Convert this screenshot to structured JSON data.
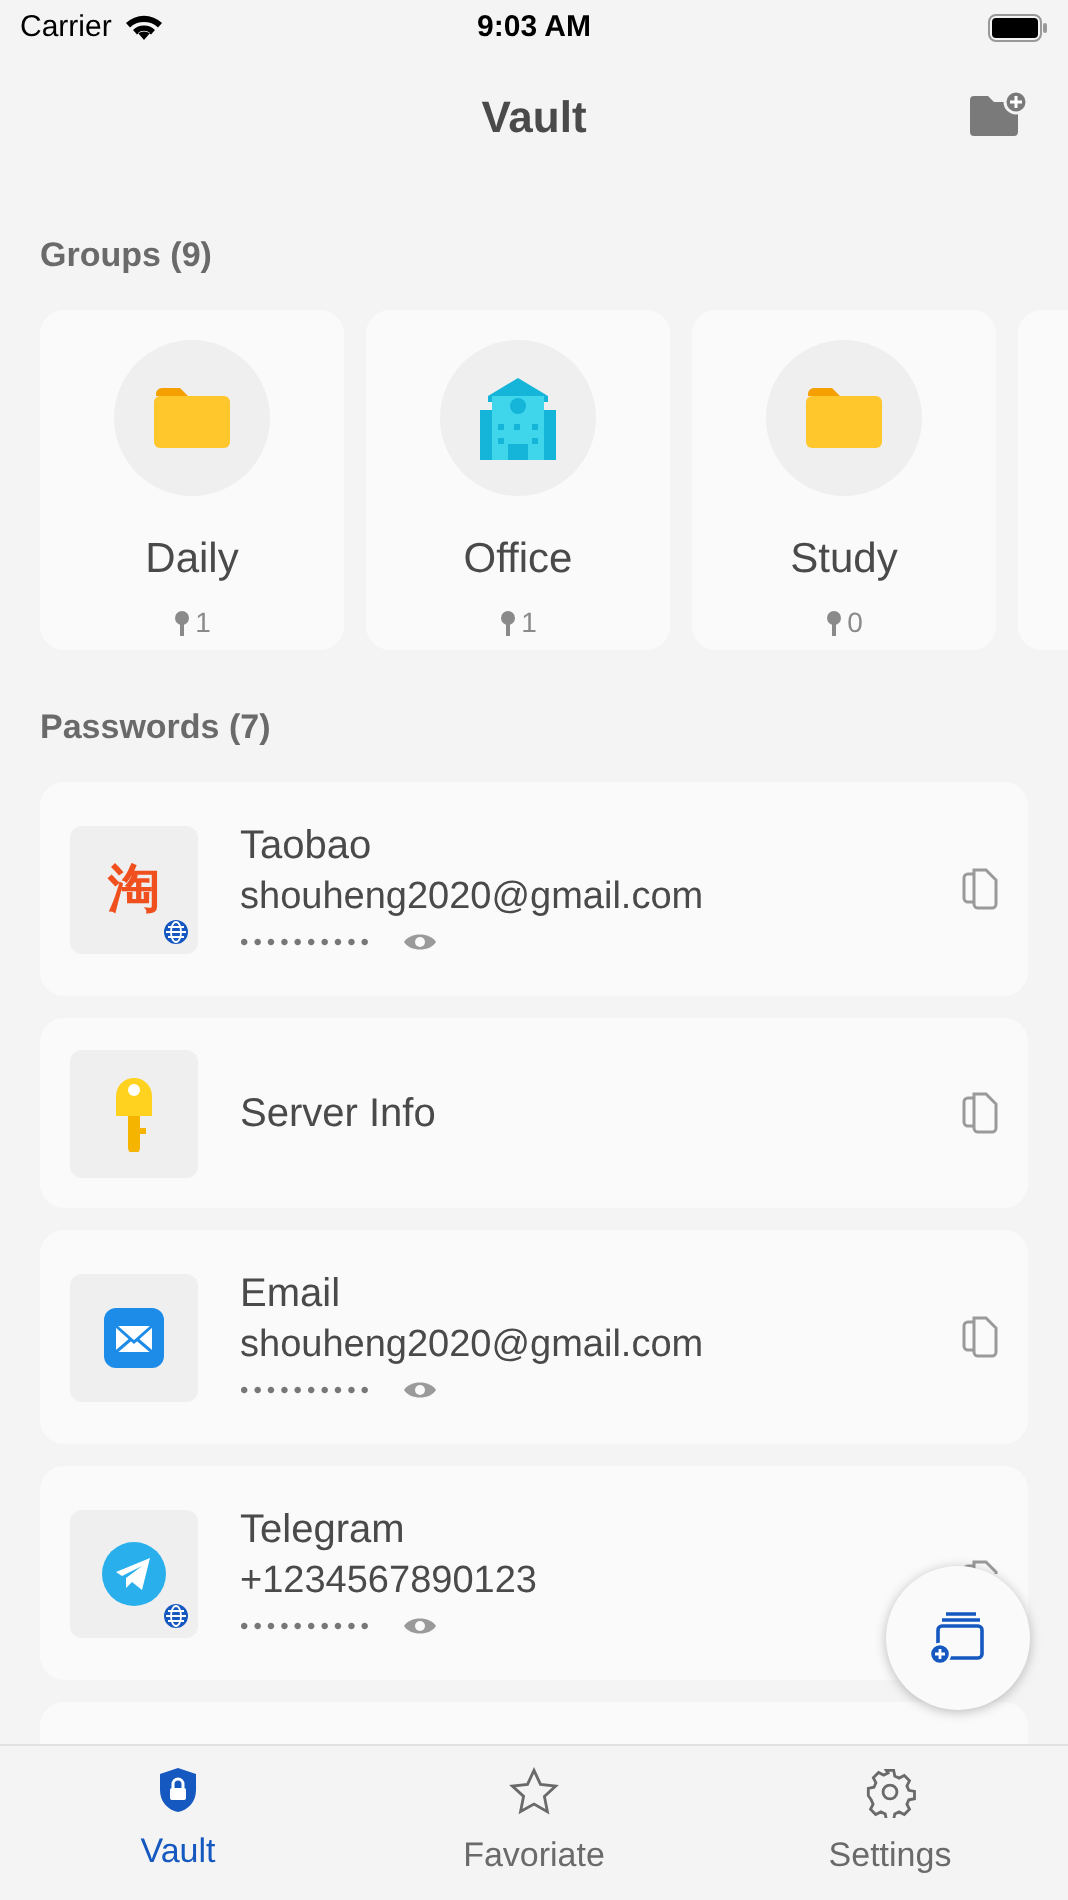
{
  "status_bar": {
    "carrier": "Carrier",
    "time": "9:03 AM"
  },
  "header": {
    "title": "Vault"
  },
  "groups": {
    "heading": "Groups (9)",
    "items": [
      {
        "name": "Daily",
        "count": "1",
        "kind": "folder"
      },
      {
        "name": "Office",
        "count": "1",
        "kind": "building"
      },
      {
        "name": "Study",
        "count": "0",
        "kind": "folder"
      }
    ]
  },
  "passwords": {
    "heading": "Passwords (7)",
    "items": [
      {
        "title": "Taobao",
        "account": "shouheng2020@gmail.com",
        "masked": "••••••••••",
        "kind": "taobao",
        "icon_text": "淘",
        "web": true
      },
      {
        "title": "Server Info",
        "kind": "key",
        "web": false
      },
      {
        "title": "Email",
        "account": "shouheng2020@gmail.com",
        "masked": "••••••••••",
        "kind": "mail",
        "web": false
      },
      {
        "title": "Telegram",
        "account": "+1234567890123",
        "masked": "••••••••••",
        "kind": "telegram",
        "web": true
      }
    ]
  },
  "tabs": [
    {
      "label": "Vault",
      "selected": true,
      "kind": "vault"
    },
    {
      "label": "Favoriate",
      "selected": false,
      "kind": "star"
    },
    {
      "label": "Settings",
      "selected": false,
      "kind": "gear"
    }
  ]
}
